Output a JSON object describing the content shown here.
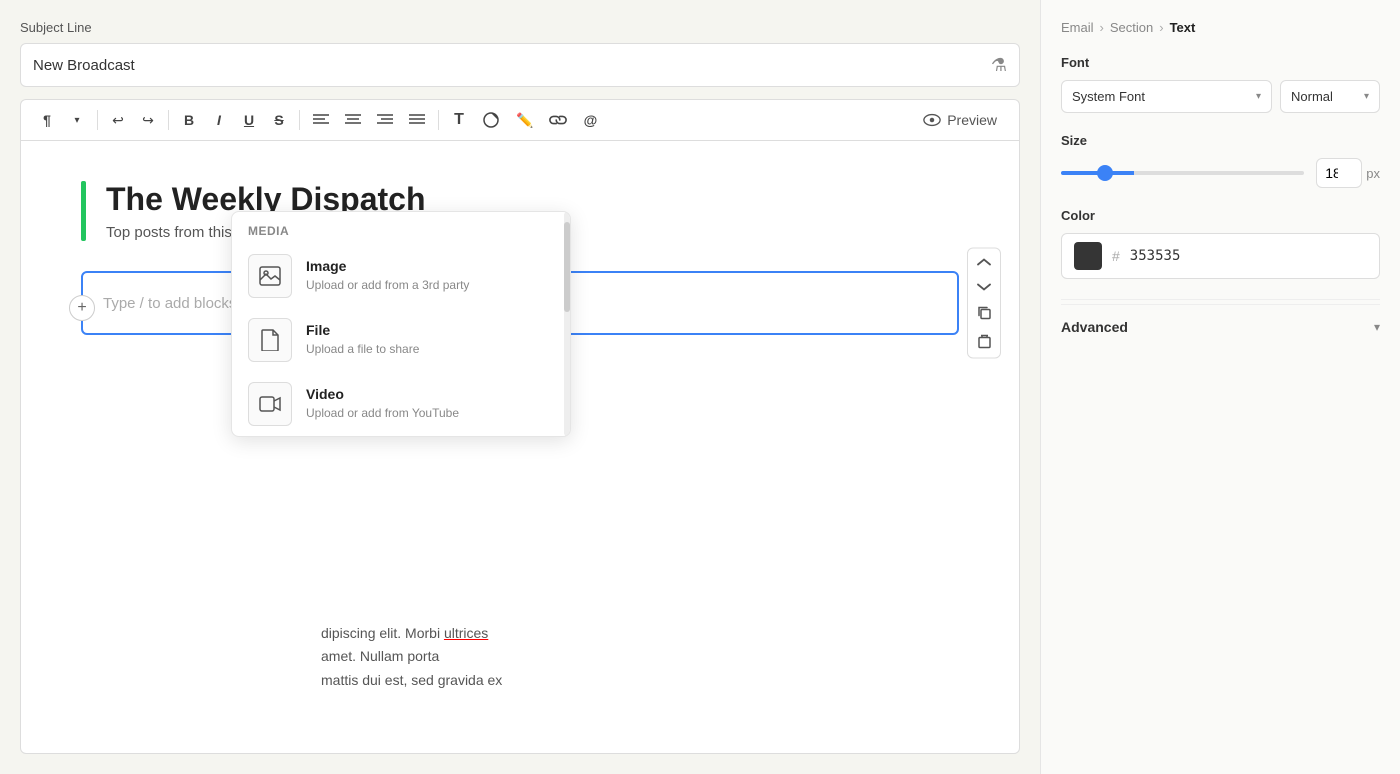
{
  "subject": {
    "label": "Subject Line",
    "value": "New Broadcast",
    "flask_icon": "⚗"
  },
  "toolbar": {
    "buttons": [
      {
        "id": "paragraph",
        "label": "¶",
        "type": "dropdown"
      },
      {
        "id": "undo",
        "label": "↩"
      },
      {
        "id": "redo",
        "label": "↪"
      },
      {
        "id": "bold",
        "label": "B"
      },
      {
        "id": "italic",
        "label": "I"
      },
      {
        "id": "underline",
        "label": "U"
      },
      {
        "id": "strikethrough",
        "label": "S"
      },
      {
        "id": "align-left",
        "label": "≡"
      },
      {
        "id": "align-center",
        "label": "≡"
      },
      {
        "id": "align-right",
        "label": "≡"
      },
      {
        "id": "align-justify",
        "label": "≡"
      },
      {
        "id": "text-size",
        "label": "T"
      },
      {
        "id": "fill",
        "label": "◉"
      },
      {
        "id": "color",
        "label": "✏"
      },
      {
        "id": "link",
        "label": "🔗"
      },
      {
        "id": "mention",
        "label": "@"
      }
    ],
    "preview_label": "Preview"
  },
  "canvas": {
    "header": {
      "title": "The Weekly Dispatch",
      "subtitle": "Top posts from this week"
    },
    "active_block": {
      "placeholder": "Type / to add blocks"
    },
    "background_text": {
      "line1": "dipiscing elit. Morbi ultrices",
      "line2": "amet. Nullam porta",
      "line3": "mattis dui est, sed gravida ex"
    }
  },
  "dropdown": {
    "section_label": "Media",
    "items": [
      {
        "name": "Image",
        "description": "Upload or add from a 3rd party",
        "icon": "🖼"
      },
      {
        "name": "File",
        "description": "Upload a file to share",
        "icon": "📄"
      },
      {
        "name": "Video",
        "description": "Upload or add from YouTube",
        "icon": "🎬"
      }
    ]
  },
  "right_panel": {
    "breadcrumb": {
      "email": "Email",
      "section": "Section",
      "current": "Text"
    },
    "font": {
      "label": "Font",
      "family": "System Font",
      "style": "Normal"
    },
    "size": {
      "label": "Size",
      "value": 18,
      "unit": "px"
    },
    "color": {
      "label": "Color",
      "hex": "353535"
    },
    "advanced": {
      "label": "Advanced"
    }
  }
}
